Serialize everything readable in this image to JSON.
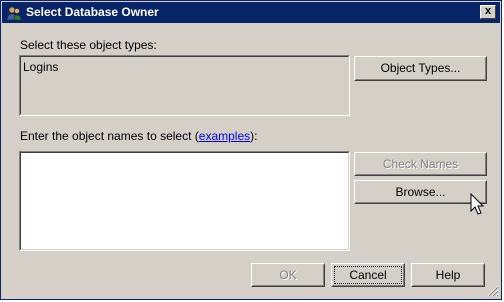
{
  "window": {
    "title": "Select Database Owner",
    "close_label": "x"
  },
  "object_types": {
    "label": "Select these object types:",
    "value": "Logins",
    "button": "Object Types..."
  },
  "object_names": {
    "label_prefix": "Enter the object names to select (",
    "link": "examples",
    "label_suffix": "):",
    "value": "",
    "check_names_button": "Check Names",
    "browse_button": "Browse..."
  },
  "footer": {
    "ok": "OK",
    "cancel": "Cancel",
    "help": "Help"
  }
}
